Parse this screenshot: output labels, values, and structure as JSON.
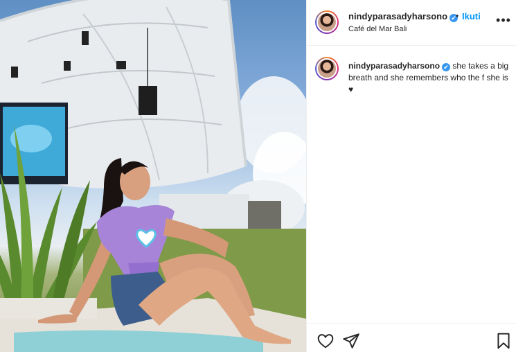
{
  "post": {
    "username": "nindyparasadyharsono",
    "verified_mark": "✔",
    "separator": "•",
    "follow_label": "Ikuti",
    "location": "Café del Mar Bali",
    "more_label": "•••"
  },
  "caption": {
    "username": "nindyparasadyharsono",
    "text": "she takes a big breath and she remembers who the f she is ♥"
  },
  "actions": {
    "icons": [
      "heart-icon",
      "share-icon",
      "bookmark-icon"
    ]
  },
  "colors": {
    "link_blue": "#0095f6",
    "verified_blue": "#3897f0",
    "text": "#262626",
    "divider": "#efefef",
    "top_purple": "#a784d8"
  }
}
